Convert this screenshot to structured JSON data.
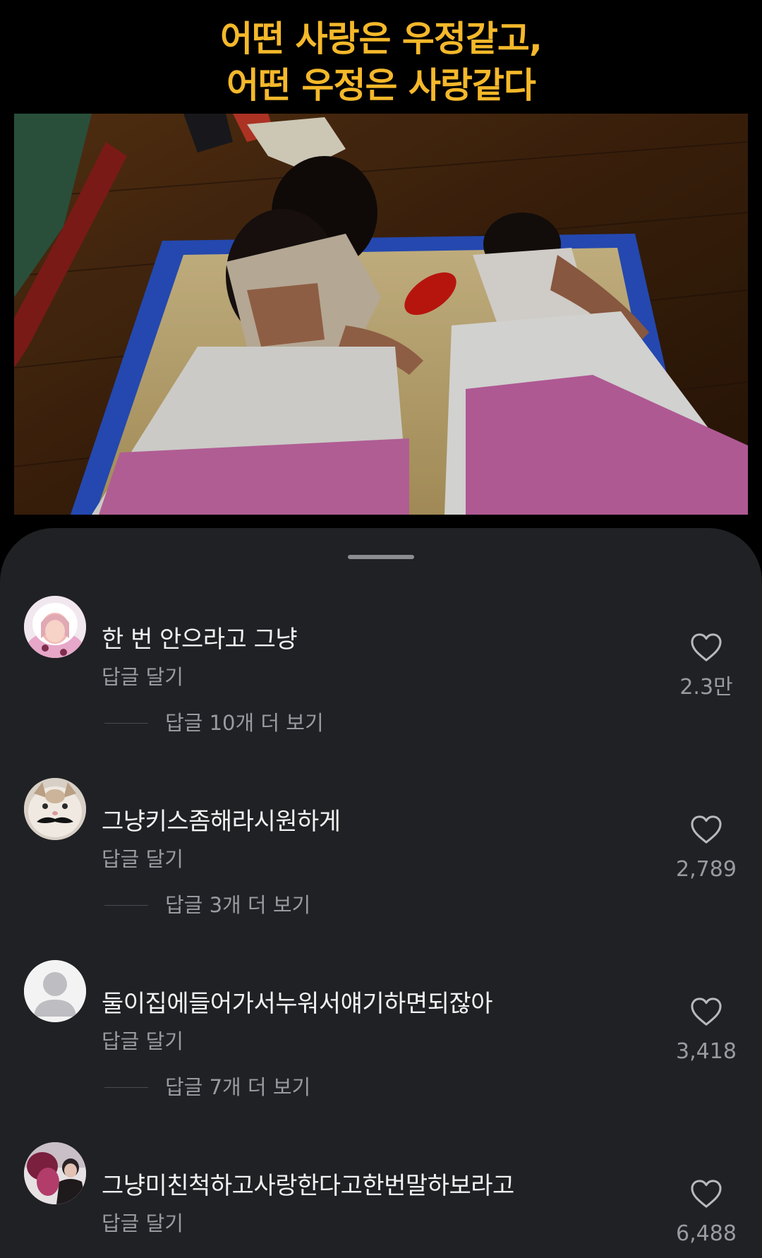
{
  "video": {
    "caption_line1": "어떤 사랑은 우정같고,",
    "caption_line2": "어떤 우정은 사랑같다",
    "caption_color": "#F4B82A"
  },
  "comments": [
    {
      "text": "한 번 안으라고 그냥",
      "reply_label": "답글 달기",
      "more_replies": "답글 10개 더 보기",
      "likes": "2.3만"
    },
    {
      "text": "그냥키스좀해라시원하게",
      "reply_label": "답글 달기",
      "more_replies": "답글 3개 더 보기",
      "likes": "2,789"
    },
    {
      "text": "둘이집에들어가서누워서얘기하면되잖아",
      "reply_label": "답글 달기",
      "more_replies": "답글 7개 더 보기",
      "likes": "3,418"
    },
    {
      "text": "그냥미친척하고사랑한다고한번말하보라고",
      "reply_label": "답글 달기",
      "likes": "6,488"
    }
  ],
  "icons": {
    "like": "heart-icon",
    "default_avatar": "person-silhouette-icon"
  },
  "colors": {
    "sheet_background": "#202125",
    "primary_text": "#f2f2f2",
    "secondary_text": "#9a9ba0"
  }
}
